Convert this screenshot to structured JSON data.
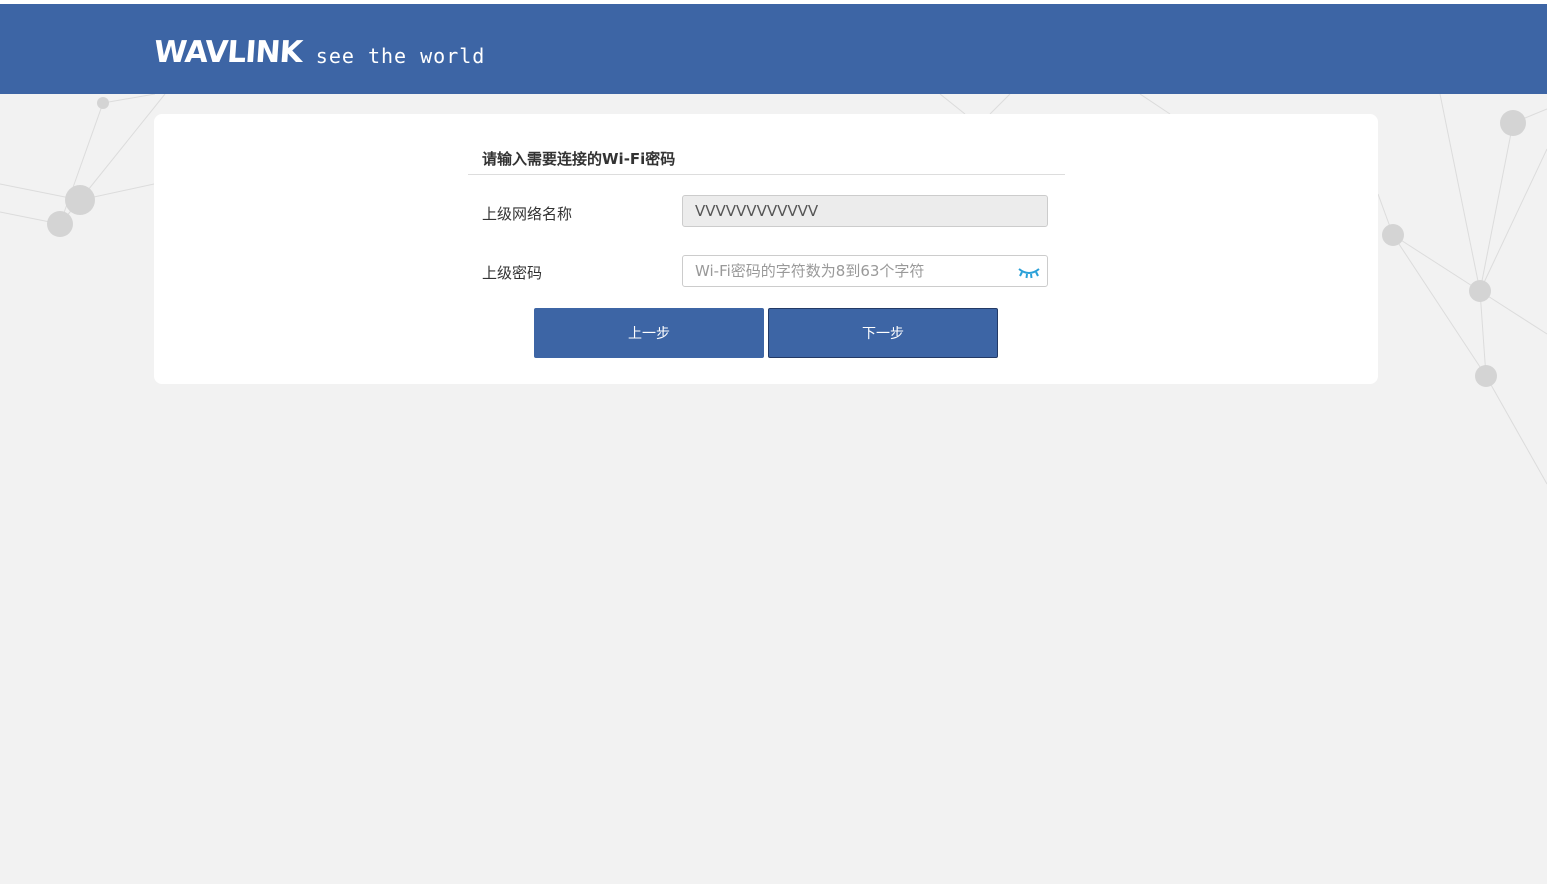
{
  "header": {
    "brand": "WAVLINK",
    "tagline": "see the world",
    "color": "#3d65a5"
  },
  "form": {
    "title": "请输入需要连接的Wi-Fi密码",
    "ssid_label": "上级网络名称",
    "ssid_value": "VVVVVVVVVVVV",
    "password_label": "上级密码",
    "password_value": "",
    "password_placeholder": "Wi-Fi密码的字符数为8到63个字符",
    "toggle_icon": "eye-closed-icon"
  },
  "buttons": {
    "prev_label": "上一步",
    "next_label": "下一步"
  }
}
